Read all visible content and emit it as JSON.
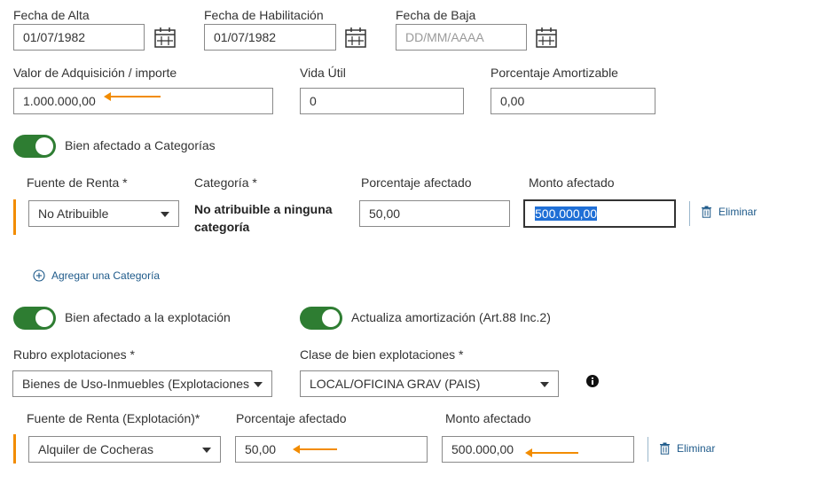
{
  "dates": {
    "alta_label": "Fecha de Alta",
    "alta_value": "01/07/1982",
    "habilitacion_label": "Fecha de Habilitación",
    "habilitacion_value": "01/07/1982",
    "baja_label": "Fecha de Baja",
    "baja_placeholder": "DD/MM/AAAA"
  },
  "valores": {
    "adquisicion_label": "Valor de Adquisición / importe",
    "adquisicion_value": "1.000.000,00",
    "vida_util_label": "Vida Útil",
    "vida_util_value": "0",
    "porcentaje_label": "Porcentaje Amortizable",
    "porcentaje_value": "0,00"
  },
  "categorias": {
    "toggle_label": "Bien afectado a Categorías",
    "toggle_on": true,
    "fuente_label": "Fuente de Renta *",
    "fuente_value": "No Atribuible",
    "categoria_label": "Categoría *",
    "categoria_value_line1": "No atribuible a ninguna",
    "categoria_value_line2": "categoría",
    "porcentaje_label": "Porcentaje afectado",
    "porcentaje_value": "50,00",
    "monto_label": "Monto afectado",
    "monto_value": "500.000,00",
    "eliminar_label": "Eliminar",
    "agregar_label": "Agregar una Categoría"
  },
  "explotacion": {
    "toggle_label": "Bien afectado a la explotación",
    "toggle_on": true,
    "actualiza_label": "Actualiza amortización (Art.88 Inc.2)",
    "actualiza_on": true,
    "rubro_label": "Rubro explotaciones *",
    "rubro_value": "Bienes de Uso-Inmuebles (Explotaciones",
    "clase_label": "Clase de bien explotaciones *",
    "clase_value": "LOCAL/OFICINA GRAV (PAIS)",
    "fuente_label": "Fuente de Renta (Explotación)*",
    "fuente_value": "Alquiler de Cocheras",
    "porcentaje_label": "Porcentaje afectado",
    "porcentaje_value": "50,00",
    "monto_label": "Monto afectado",
    "monto_value": "500.000,00",
    "eliminar_label": "Eliminar"
  },
  "icons": {
    "calendar": "calendar-icon",
    "trash": "trash-icon",
    "add": "plus-circle-icon",
    "info": "info-icon",
    "dropdown": "chevron-down-icon",
    "annotation": "arrow-annotation"
  },
  "colors": {
    "toggle_on": "#2e7d32",
    "accent_bar": "#f28c00",
    "link": "#1e5a8a",
    "selection": "#1f6fd6"
  }
}
